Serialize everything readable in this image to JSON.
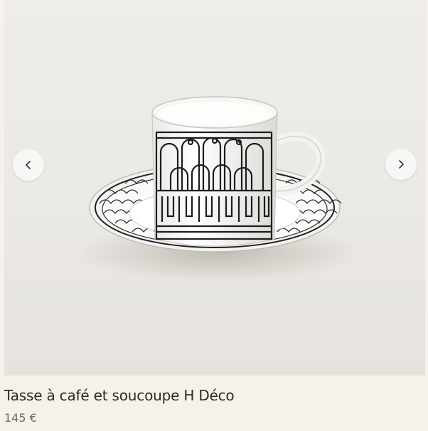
{
  "product": {
    "title": "Tasse à café et soucoupe H Déco",
    "price": "145 €"
  },
  "gallery": {
    "image_subject": "cup-and-saucer",
    "prev_icon": "chevron-left-icon",
    "next_icon": "chevron-right-icon"
  },
  "colors": {
    "page_background": "#f6f1ea",
    "image_background": "#ebe9e5",
    "title_text": "#2c2a27",
    "price_text": "#6e6a63"
  }
}
